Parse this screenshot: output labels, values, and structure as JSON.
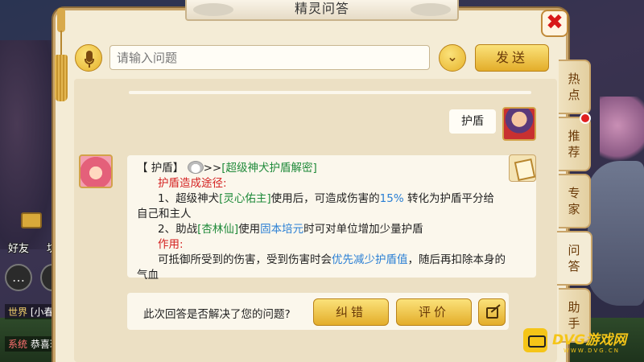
{
  "dialog": {
    "title": "精灵问答",
    "close_label": "✖"
  },
  "input": {
    "placeholder": "请输入问题",
    "value": "",
    "dropdown_glyph": "⌄",
    "send_label": "发送"
  },
  "conversation": {
    "user_message": "护盾",
    "answer": {
      "header_prefix": "【 护盾】",
      "header_arrows": ">>",
      "header_topic": "[超级神犬护盾解密]",
      "section1_title": "护盾造成途径:",
      "item1_a": "1、超级神犬",
      "item1_skill": "[灵心佑主]",
      "item1_b": "使用后，可造成伤害的",
      "item1_pct": "15%",
      "item1_c": " 转化为护盾平分给",
      "item1_cont": "自己和主人",
      "item2_a": "2、助战",
      "item2_partner": "[杏林仙]",
      "item2_b": "使用",
      "item2_skill": "固本培元",
      "item2_c": "时可对单位增加少量护盾",
      "section2_title": "作用:",
      "effect_a": "可抵御所受到的伤害，受到伤害时会",
      "effect_highlight": "优先减少护盾值",
      "effect_b": "，随后再扣除本身的",
      "effect_cont": "气血"
    },
    "feedback_question": "此次回答是否解决了您的问题?",
    "correct_label": "纠错",
    "rate_label": "评价"
  },
  "side_tabs": [
    {
      "label": "热点"
    },
    {
      "label": "推荐"
    },
    {
      "label": "专家"
    },
    {
      "label": "问答"
    },
    {
      "label": "助手"
    }
  ],
  "hud": {
    "friend_label": "好友",
    "other_label": "坊",
    "chat_glyph": "…",
    "channel_world_tag": "世界",
    "channel_world_text": "[小春",
    "channel_sys_tag": "系统",
    "channel_sys_text": "恭喜玩"
  },
  "watermark": {
    "brand": "DVG游戏网",
    "url": "WWW.DVG.CN"
  },
  "colors": {
    "panel_bg": "#f4ecd6",
    "button_gold": "#e3ad2a",
    "highlight_red": "#d42020",
    "highlight_green": "#1f8a3a",
    "highlight_blue": "#2a7fd4",
    "close_red": "#d81818"
  }
}
